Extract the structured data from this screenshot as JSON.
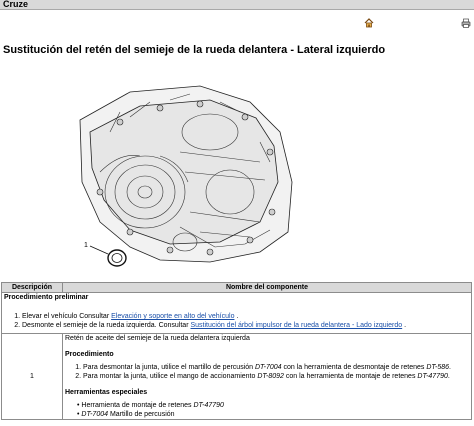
{
  "app": {
    "title": "Cruze"
  },
  "toolbar": {
    "icons": [
      "home-icon",
      "print-icon"
    ]
  },
  "page": {
    "title": "Sustitución del retén del semieje de la rueda delantera - Lateral izquierdo"
  },
  "figure": {
    "callout": "1"
  },
  "table": {
    "headers": [
      "Descripción",
      "Nombre del componente"
    ],
    "preliminary": {
      "heading": "Procedimiento preliminar",
      "steps": [
        {
          "text": "Elevar el vehículo Consultar ",
          "link": "Elevación y soporte en alto del vehículo",
          "after": " ."
        },
        {
          "text": "Desmonte el semieje de la rueda izquierda. Consultar ",
          "link": "Sustitución del árbol impulsor de la rueda delantera - Lado izquierdo",
          "after": " ."
        }
      ]
    },
    "row1": {
      "number": "1",
      "component": "Retén de aceite del semieje de la rueda delantera izquierda",
      "procedure_heading": "Procedimiento",
      "procedure": [
        {
          "pre": "Para desmontar la junta, utilice el martillo de percusión ",
          "tool1": "DT-7004",
          "mid": " con la herramienta de desmontaje de retenes ",
          "tool2": "DT-586",
          "post": "."
        },
        {
          "pre": "Para montar la junta, utilice el mango de accionamiento ",
          "tool1": "DT-8092",
          "mid": " con la herramienta de montaje de retenes ",
          "tool2": "DT-47790",
          "post": "."
        }
      ],
      "tools_heading": "Herramientas especiales",
      "tools": [
        {
          "name": "Herramienta de montaje de retenes ",
          "code": "DT-47790"
        },
        {
          "code": "DT-7004",
          "name": " Martillo de percusión"
        }
      ]
    }
  }
}
